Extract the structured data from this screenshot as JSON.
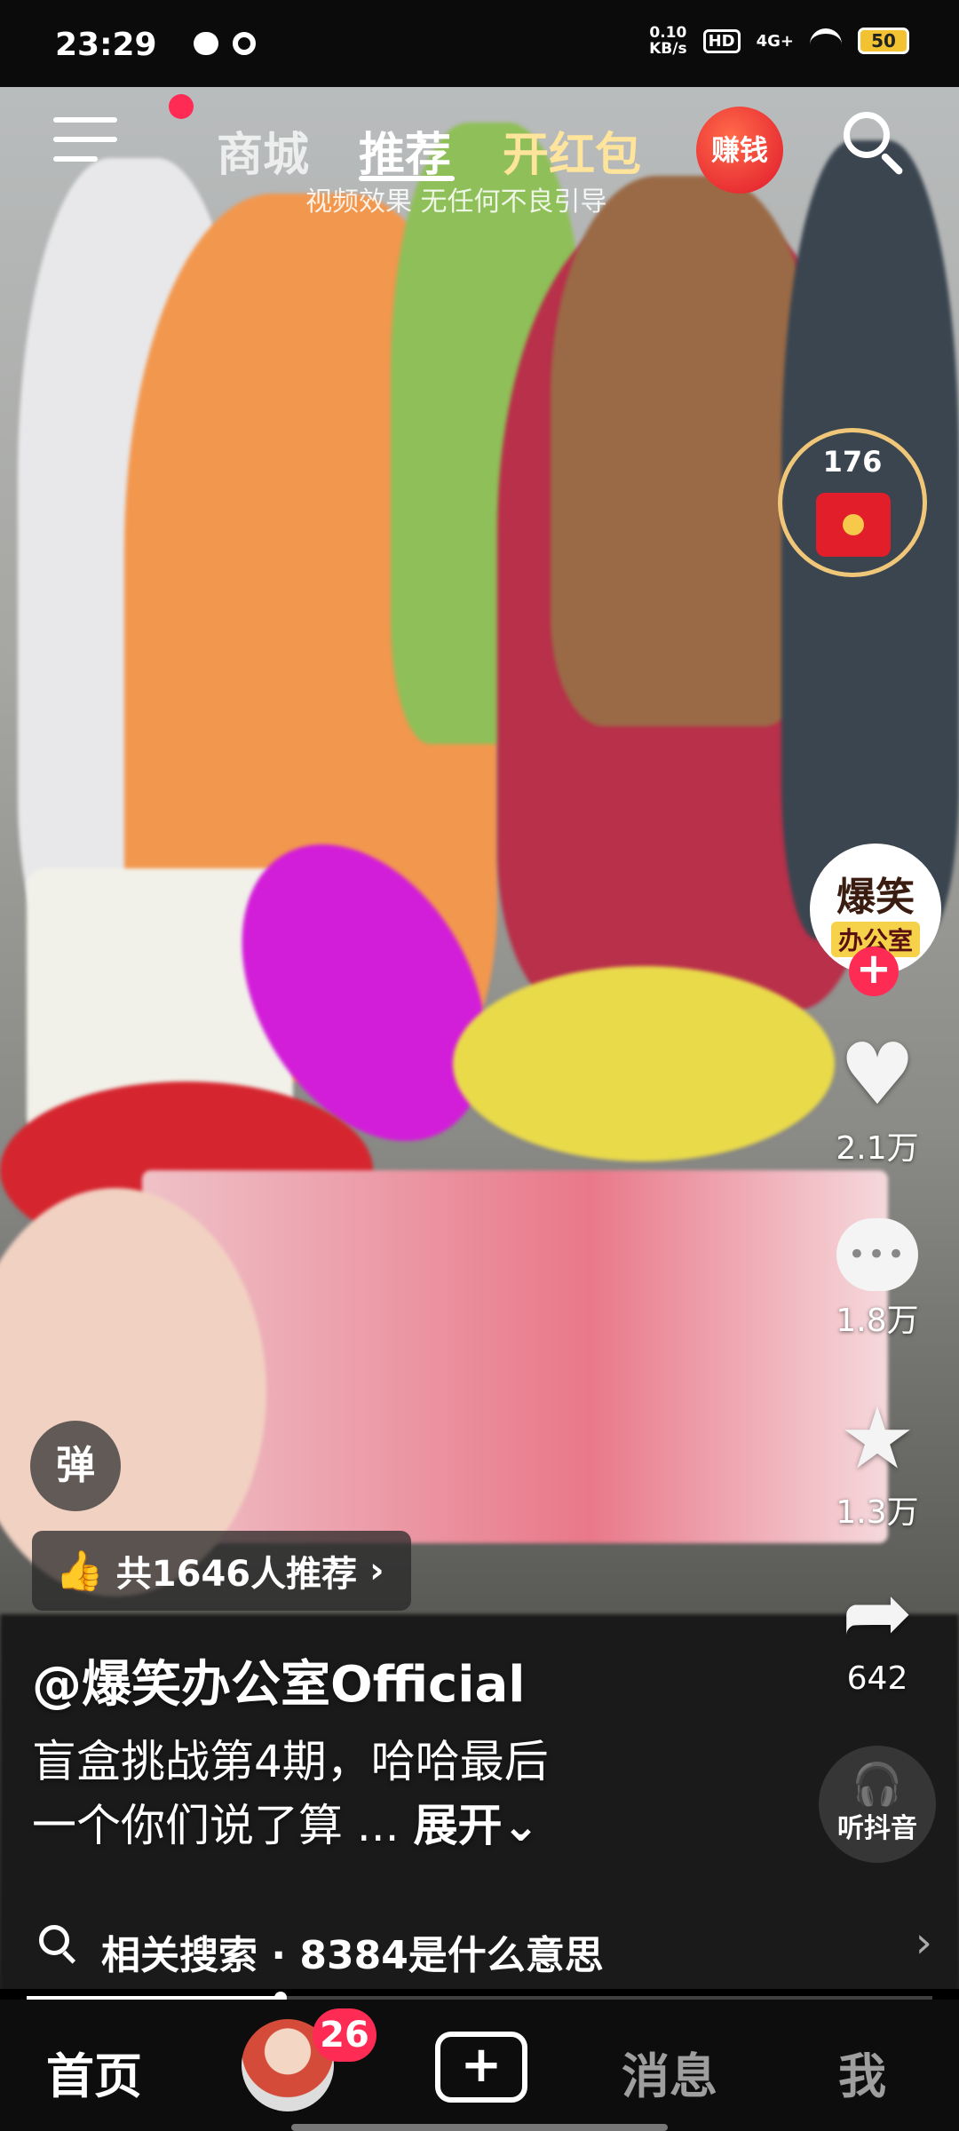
{
  "status_bar": {
    "time": "23:29",
    "net_speed_value": "0.10",
    "net_speed_unit": "KB/s",
    "hd": "HD",
    "signal": "4G+",
    "battery": "50"
  },
  "top_nav": {
    "tabs": [
      {
        "label": "商城"
      },
      {
        "label": "推荐"
      },
      {
        "label": "开红包"
      }
    ],
    "earn_label": "赚钱",
    "video_caption": "视频效果 无任何不良引导"
  },
  "right_rail": {
    "red_packet_count": "176",
    "author_avatar_line1": "爆笑",
    "author_avatar_line2": "办公室",
    "like_count": "2.1万",
    "comment_count": "1.8万",
    "favorite_count": "1.3万",
    "share_count": "642",
    "listen_label": "听抖音"
  },
  "overlay": {
    "danmu_label": "弹",
    "recommend_text": "共1646人推荐",
    "author_handle": "@爆笑办公室Official",
    "description_line1": "盲盒挑战第4期，哈哈最后",
    "description_line2": "一个你们说了算 ...",
    "expand_label": "展开"
  },
  "related_search": {
    "label": "相关搜索 · 8384是什么意思"
  },
  "playback_progress": 0.28,
  "tab_bar": {
    "home": "首页",
    "friends_badge": "26",
    "messages": "消息",
    "me": "我"
  },
  "colors": {
    "accent_red": "#fe2c55",
    "highlight_tab": "#ffe49b"
  }
}
